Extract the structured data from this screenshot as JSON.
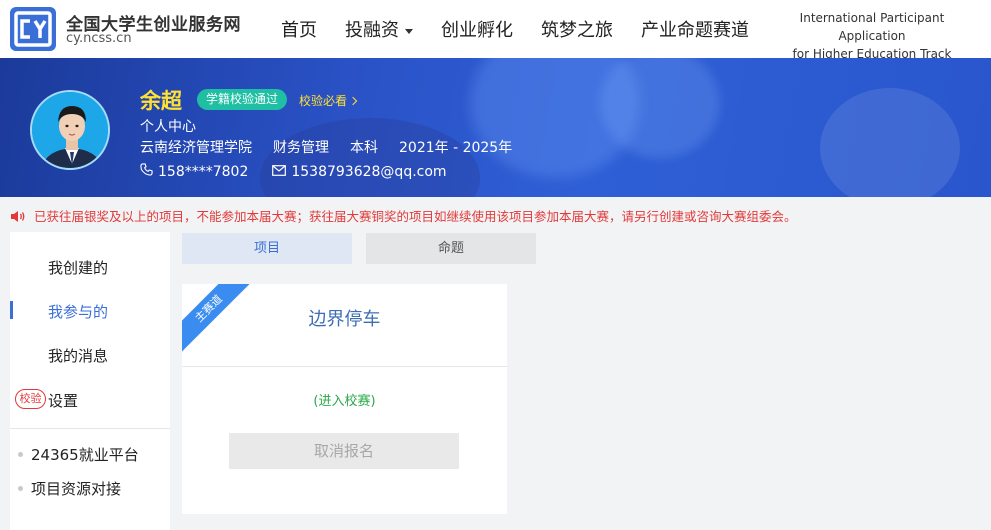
{
  "site": {
    "title": "全国大学生创业服务网",
    "url": "cy.ncss.cn",
    "logo_text": "cy"
  },
  "nav": {
    "items": [
      "首页",
      "投融资",
      "创业孵化",
      "筑梦之旅",
      "产业命题赛道"
    ],
    "intl_line1": "International Participant Application",
    "intl_line2": "for Higher Education Track"
  },
  "profile": {
    "name": "余超",
    "badge": "学籍校验通过",
    "verify_link": "校验必看",
    "center": "个人中心",
    "school": "云南经济管理学院",
    "major": "财务管理",
    "degree": "本科",
    "years": "2021年 - 2025年",
    "phone": "158****7802",
    "email": "1538793628@qq.com"
  },
  "notice": {
    "text": "已获往届银奖及以上的项目，不能参加本届大赛；获往届大赛铜奖的项目如继续使用该项目参加本届大赛，请另行创建或咨询大赛组委会。"
  },
  "sidebar": {
    "items": [
      "我创建的",
      "我参与的",
      "我的消息",
      "设置"
    ],
    "active": "我参与的",
    "stamp": "校验",
    "links": [
      "24365就业平台",
      "项目资源对接"
    ]
  },
  "tabs": [
    "项目",
    "命题"
  ],
  "project_card": {
    "ribbon": "主赛道",
    "title": "边界停车",
    "status": "(进入校赛)",
    "action": "取消报名"
  },
  "colors": {
    "brand_blue": "#3a6fd8",
    "banner_blue": "#2a52c6",
    "name_yellow": "#ffe033",
    "badge_teal": "#1fbfa3",
    "notice_red": "#e23a3a",
    "status_green": "#2da84a"
  }
}
